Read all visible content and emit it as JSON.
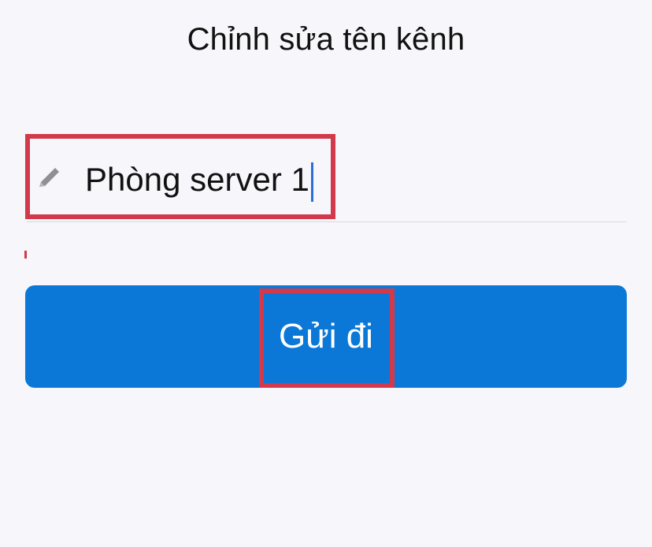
{
  "dialog": {
    "title": "Chỉnh sửa tên kênh"
  },
  "form": {
    "channel_name_value": "Phòng server 1",
    "icon": "pencil-icon"
  },
  "actions": {
    "submit_label": "Gửi đi"
  },
  "colors": {
    "button_bg": "#0b78d8",
    "highlight": "#d23a4b",
    "caret": "#2b6fd6"
  }
}
